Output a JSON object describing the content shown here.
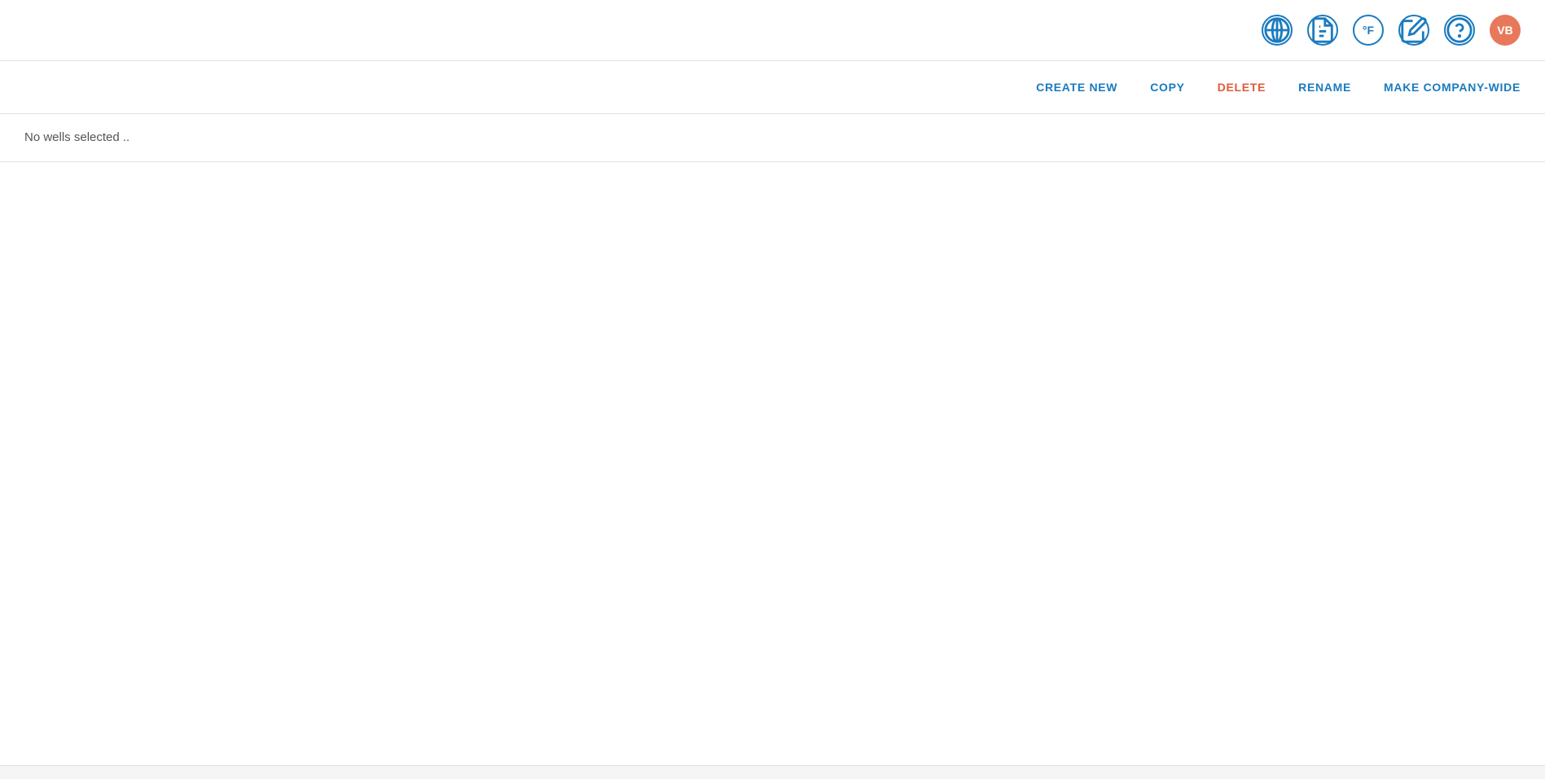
{
  "topbar": {
    "icons": [
      {
        "name": "globe-icon",
        "label": "Globe"
      },
      {
        "name": "document-icon",
        "label": "Document"
      },
      {
        "name": "temperature-icon",
        "label": "Temperature"
      },
      {
        "name": "edit-icon",
        "label": "Edit"
      },
      {
        "name": "help-icon",
        "label": "Help"
      }
    ],
    "avatar": {
      "initials": "VB",
      "bg_color": "#e8785a"
    }
  },
  "toolbar": {
    "create_new_label": "CREATE NEW",
    "copy_label": "COPY",
    "delete_label": "DELETE",
    "rename_label": "RENAME",
    "make_company_wide_label": "MAKE COMPANY-WIDE"
  },
  "main": {
    "no_wells_text": "No wells selected .."
  }
}
